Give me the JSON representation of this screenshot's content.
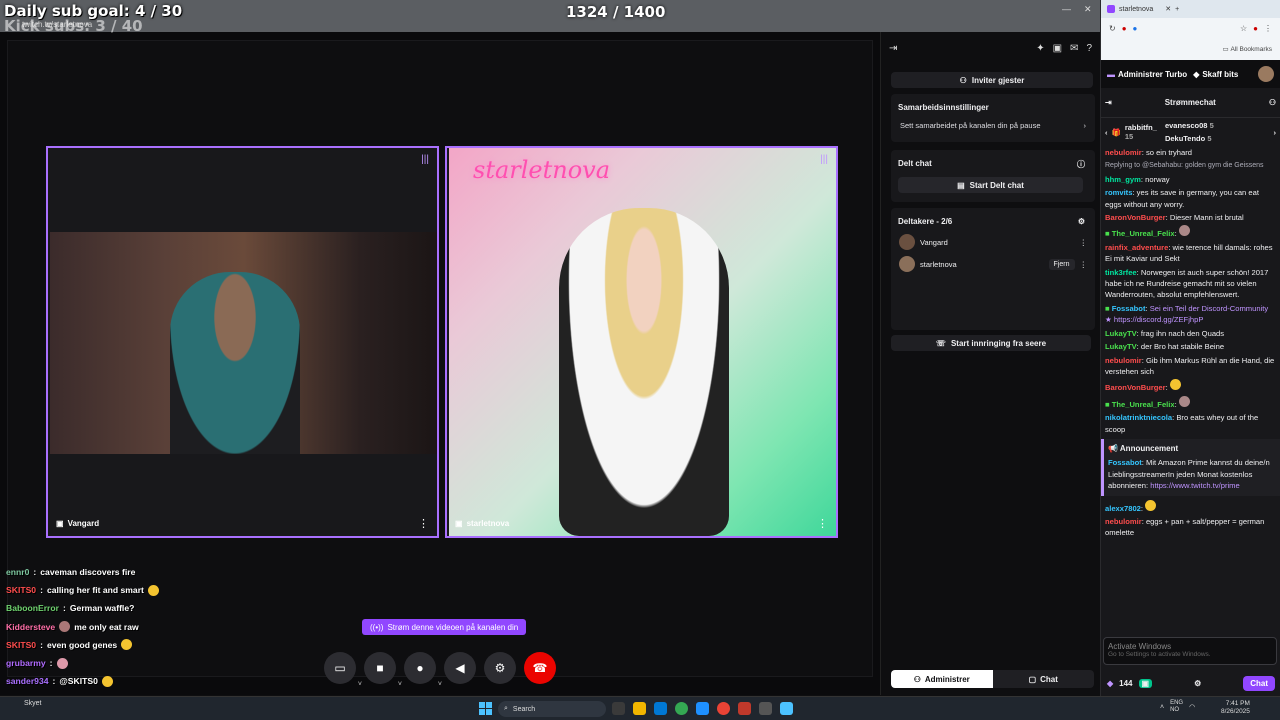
{
  "overlay": {
    "goal": "Daily sub goal: 4 / 30",
    "kick": "Kick subs: 3 / 40",
    "count": "1324 / 1400"
  },
  "left_chrome": {
    "tab": "twitch.tv/starletnova"
  },
  "stage": {
    "tiles": [
      {
        "name": "Vangard"
      },
      {
        "name": "starletnova",
        "overlay_logo": "starletnova"
      }
    ],
    "stream_button": "Strøm denne videoen på kanalen din",
    "controls": [
      "monitor-icon",
      "camera-icon",
      "mic-icon",
      "speaker-icon",
      "gear-icon",
      "hangup-icon"
    ]
  },
  "overlay_chat": [
    {
      "user": "ennr0",
      "text": "caveman discovers fire",
      "color": "#7ec8a0"
    },
    {
      "user": "SKITS0",
      "text": "calling her fit and smart",
      "color": "#ff4d4d"
    },
    {
      "user": "BaboonError",
      "text": "German waffle?",
      "color": "#6fd36f"
    },
    {
      "user": "Kiddersteve",
      "text": "me only eat raw",
      "color": "#ff6fa8"
    },
    {
      "user": "SKITS0",
      "text": "even good genes",
      "color": "#ff4d4d"
    },
    {
      "user": "grubarmy",
      "text": "",
      "color": "#b06bff"
    },
    {
      "user": "sander934",
      "text": "@SKITS0",
      "color": "#a970ff"
    }
  ],
  "panel": {
    "invite": "Inviter gjester",
    "collab_title": "Samarbeidsinnstillinger",
    "collab_sub": "Sett samarbeidet på kanalen din på pause",
    "shared_title": "Delt chat",
    "shared_btn": "Start Delt chat",
    "participants_title": "Deltakere - 2/6",
    "participants": [
      {
        "name": "Vangard",
        "action": ""
      },
      {
        "name": "starletnova",
        "action": "Fjern"
      }
    ],
    "viewer_btn": "Start innringing fra seere",
    "foot": {
      "manage": "Administrer",
      "chat": "Chat"
    }
  },
  "browser": {
    "tab": "starletnova",
    "bookmarks": "All Bookmarks"
  },
  "twitch": {
    "turbo": "Administrer Turbo",
    "bits": "Skaff bits",
    "chat_title": "Strømmechat",
    "gifts": [
      {
        "name": "rabbitfn_",
        "count": "15"
      },
      {
        "name": "evanesco08",
        "count": "5"
      },
      {
        "name": "DekuTendo",
        "count": "5"
      }
    ],
    "messages": [
      {
        "user": "nebulomir",
        "color": "#ff4d4d",
        "text": "so ein tryhard"
      },
      {
        "user": "",
        "color": "#adadb8",
        "text": "Replying to @Sebahabu: golden gym die Geissens"
      },
      {
        "user": "hhm_gym",
        "color": "#00e6a0",
        "text": "norway"
      },
      {
        "user": "romvits",
        "color": "#35c6ff",
        "text": "yes its save in germany, you can eat eggs without any worry."
      },
      {
        "user": "BaronVonBurger",
        "color": "#ff4d4d",
        "text": "Dieser Mann ist brutal"
      },
      {
        "user": "The_Unreal_Felix",
        "color": "#49e04d",
        "text": ""
      },
      {
        "user": "rainfix_adventure",
        "color": "#ff4d4d",
        "text": "wie terence hill damals: rohes Ei mit Kaviar und Sekt"
      },
      {
        "user": "tink3rfee",
        "color": "#00e6a0",
        "text": "Norwegen ist auch super schön! 2017 habe ich ne Rundreise gemacht mit so vielen Wanderrouten, absolut empfehlenswert."
      },
      {
        "user": "Fossabot",
        "color": "#35c6ff",
        "text": "Sei ein Teil der Discord-Community ★ https://discord.gg/ZEFjhpP"
      },
      {
        "user": "LukayTV",
        "color": "#49e04d",
        "text": "frag ihn nach den Quads"
      },
      {
        "user": "LukayTV",
        "color": "#49e04d",
        "text": "der Bro hat stabile Beine"
      },
      {
        "user": "nebulomir",
        "color": "#ff4d4d",
        "text": "Gib ihm Markus Rühl an die Hand, die verstehen sich"
      },
      {
        "user": "BaronVonBurger",
        "color": "#ff4d4d",
        "text": ""
      },
      {
        "user": "The_Unreal_Felix",
        "color": "#49e04d",
        "text": ""
      },
      {
        "user": "nikolatrinktniecola",
        "color": "#35c6ff",
        "text": "Bro eats whey out of the scoop"
      }
    ],
    "announcement": {
      "title": "Announcement",
      "user": "Fossabot",
      "text": "Mit Amazon Prime kannst du deine/n LieblingsstreamerIn jeden Monat kostenlos abonnieren:",
      "link": "https://www.twitch.tv/prime"
    },
    "after": [
      {
        "user": "alexx7802",
        "color": "#35c6ff",
        "text": ""
      },
      {
        "user": "nebulomir",
        "color": "#ff4d4d",
        "text": "eggs + pan + salt/pepper = german omelette"
      }
    ],
    "input_placeholder": "Activate Windows",
    "input_sub": "Go to Settings to activate Windows.",
    "viewers": "144",
    "send": "Chat"
  },
  "taskbar": {
    "search": "Search",
    "lang1": "ENG",
    "lang2": "NO",
    "time": "7:41 PM",
    "date": "8/26/2025",
    "weather": "Skyet"
  }
}
